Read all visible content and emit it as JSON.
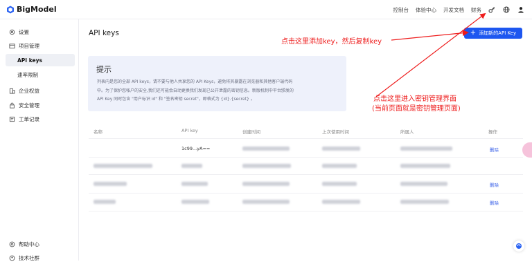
{
  "brand": {
    "name": "BigModel"
  },
  "topnav": {
    "items": [
      "控制台",
      "体验中心",
      "开发文档",
      "财务"
    ]
  },
  "sidebar": {
    "items": [
      {
        "label": "设置",
        "icon": "gear-icon"
      },
      {
        "label": "项目管理",
        "icon": "folder-icon"
      },
      {
        "label": "API keys",
        "icon": ""
      },
      {
        "label": "速率限制",
        "icon": ""
      },
      {
        "label": "企业权益",
        "icon": "building-icon"
      },
      {
        "label": "安全管理",
        "icon": "lock-icon"
      },
      {
        "label": "工单记录",
        "icon": "ticket-icon"
      }
    ],
    "bottom": [
      {
        "label": "帮助中心",
        "icon": "help-icon"
      },
      {
        "label": "技术社群",
        "icon": "community-icon"
      }
    ]
  },
  "main": {
    "title": "API keys",
    "add_button": "添加新的API Key",
    "tip": {
      "title": "提示",
      "line1": "列表内是您的全部 API keys，请不要与他人共享您的 API Keys，避免将其暴露在浏览器和其他客户端代码",
      "line2": "中。为了保护您帐户的安全,我们还可能会自动更换我们发现已公开泄露的密钥信息。新版机制中平台颁发的",
      "line3": "API Key 同时包含 \"用户标识 id\" 和 \"签名密钥 secret\"，即格式为 {id}.{secret} 。"
    },
    "table": {
      "headers": [
        "名称",
        "API key",
        "创建时间",
        "上次使用时间",
        "所属人",
        "操作"
      ],
      "row1_key": "1c99...yA==",
      "delete_label": "删除"
    }
  },
  "annotations": {
    "a1": "点击这里添加key，然后复制key",
    "a2_line1": "点击这里进入密钥管理界面",
    "a2_line2": "(当前页面就是密钥管理页面)"
  },
  "colors": {
    "accent": "#1e57f0",
    "annotation": "#ee1c1c",
    "tip_bg": "#eef1fb"
  }
}
